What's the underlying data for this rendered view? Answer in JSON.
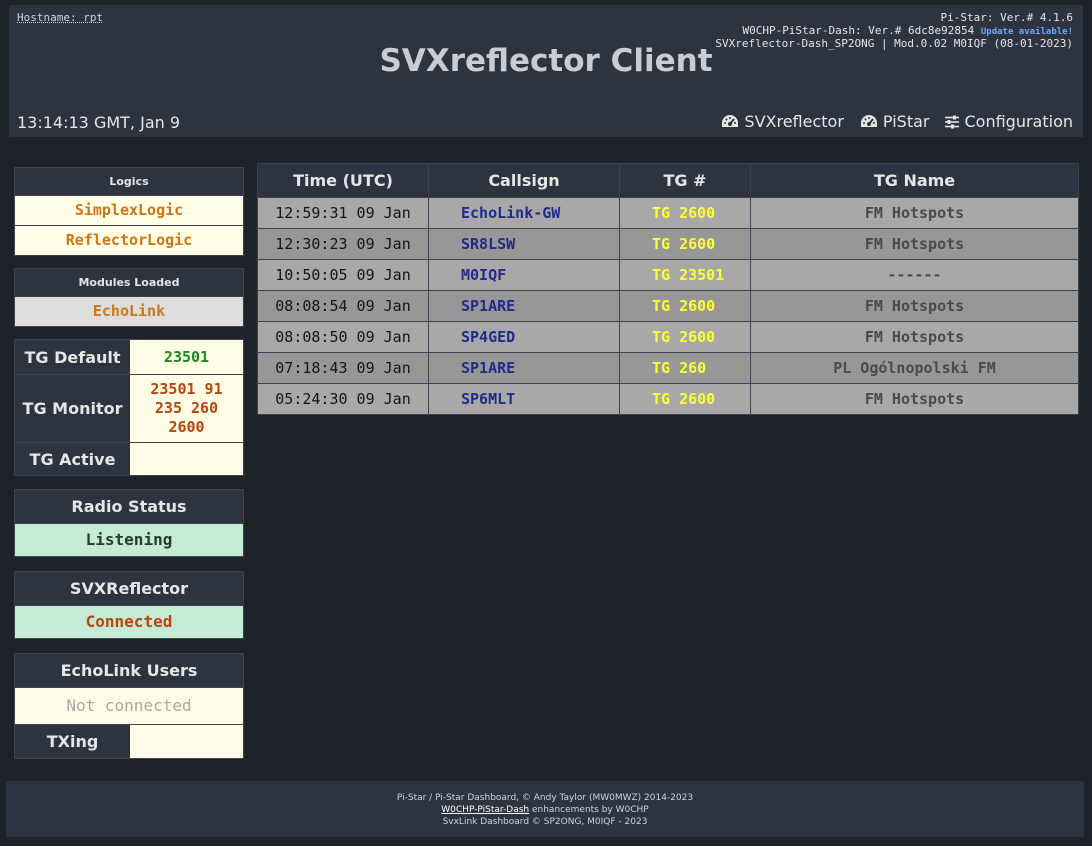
{
  "header": {
    "hostname": "Hostname: rpt",
    "version_line1": "Pi-Star: Ver.# 4.1.6",
    "version_line2": "W0CHP-PiStar-Dash: Ver.# 6dc8e92854",
    "update_notice": "Update available!",
    "version_line3": "SVXreflector-Dash_SP2ONG | Mod.0.02 M0IQF (08-01-2023)",
    "title": "SVXreflector Client",
    "clock": "13:14:13 GMT, Jan 9",
    "nav": [
      {
        "label": "SVXreflector",
        "icon": "gauge-icon"
      },
      {
        "label": "PiStar",
        "icon": "gauge-icon"
      },
      {
        "label": "Configuration",
        "icon": "sliders-icon"
      }
    ]
  },
  "logics": {
    "title": "Logics",
    "items": [
      "SimplexLogic",
      "ReflectorLogic"
    ]
  },
  "modules": {
    "title": "Modules Loaded",
    "items": [
      "EchoLink"
    ]
  },
  "tg_info": {
    "default_label": "TG Default",
    "default_value": "23501",
    "monitor_label": "TG Monitor",
    "monitor_value": "23501 91 235 260 2600",
    "active_label": "TG Active",
    "active_value": ""
  },
  "radio_status": {
    "title": "Radio Status",
    "value": "Listening"
  },
  "svxreflector": {
    "title": "SVXReflector",
    "value": "Connected"
  },
  "echolink": {
    "title": "EchoLink Users",
    "value": "Not connected",
    "txing_label": "TXing",
    "txing_value": ""
  },
  "table": {
    "headers": [
      "Time (UTC)",
      "Callsign",
      "TG #",
      "TG Name"
    ],
    "rows": [
      {
        "time": "12:59:31 09 Jan",
        "callsign": "EchoLink-GW",
        "tg": "TG 2600",
        "name": "FM Hotspots"
      },
      {
        "time": "12:30:23 09 Jan",
        "callsign": "SR8LSW",
        "tg": "TG 2600",
        "name": "FM Hotspots"
      },
      {
        "time": "10:50:05 09 Jan",
        "callsign": "M0IQF",
        "tg": "TG 23501",
        "name": "------"
      },
      {
        "time": "08:08:54 09 Jan",
        "callsign": "SP1ARE",
        "tg": "TG 2600",
        "name": "FM Hotspots"
      },
      {
        "time": "08:08:50 09 Jan",
        "callsign": "SP4GED",
        "tg": "TG 2600",
        "name": "FM Hotspots"
      },
      {
        "time": "07:18:43 09 Jan",
        "callsign": "SP1ARE",
        "tg": "TG 260",
        "name": "PL Ogólnopolski FM"
      },
      {
        "time": "05:24:30 09 Jan",
        "callsign": "SP6MLT",
        "tg": "TG 2600",
        "name": "FM Hotspots"
      }
    ]
  },
  "footer": {
    "line1": "Pi-Star / Pi-Star Dashboard, © Andy Taylor (MW0MWZ) 2014-2023",
    "line2_link": "W0CHP-PiStar-Dash",
    "line2_rest": " enhancements by W0CHP",
    "line3": "SvxLink Dashboard © SP2ONG, M0IQF - 2023"
  },
  "colors": {
    "background": "#1e2229",
    "panel": "#2d3440",
    "cream": "#fffde6",
    "green_status": "#c6ebd4",
    "tg_yellow": "#ffff33",
    "callsign_blue": "#1f2b8a"
  }
}
